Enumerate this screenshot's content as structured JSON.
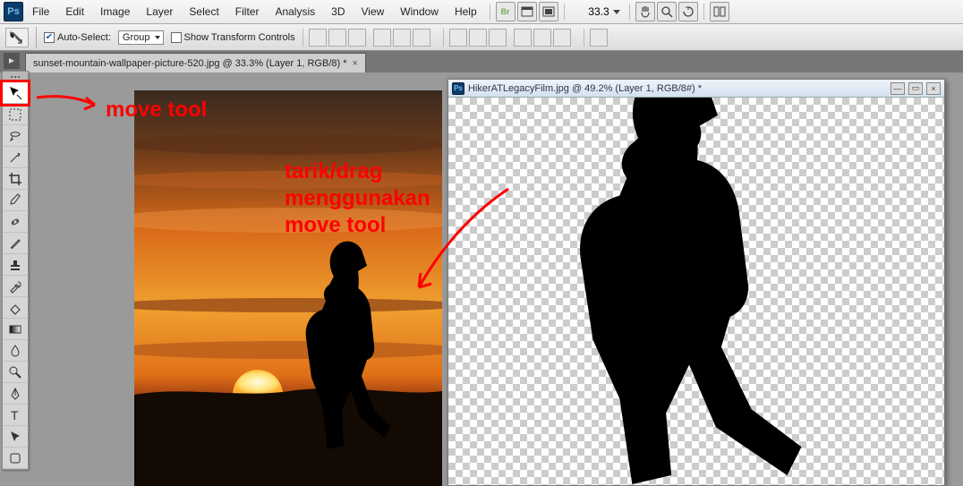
{
  "menubar": {
    "items": [
      "File",
      "Edit",
      "Image",
      "Layer",
      "Select",
      "Filter",
      "Analysis",
      "3D",
      "View",
      "Window",
      "Help"
    ],
    "zoom": "33.3"
  },
  "optionbar": {
    "auto_select_label": "Auto-Select:",
    "auto_select_value": "Group",
    "show_transform_label": "Show Transform Controls"
  },
  "document_tab": {
    "title": "sunset-mountain-wallpaper-picture-520.jpg @ 33.3% (Layer 1, RGB/8) *",
    "close": "×"
  },
  "float_window": {
    "title": "HikerATLegacyFilm.jpg @ 49.2% (Layer 1, RGB/8#) *"
  },
  "annotations": {
    "move_tool": "move tool",
    "drag_text": "tarik/drag\nmenggunakan\nmove tool"
  },
  "colors": {
    "red": "#ff0000",
    "sunset_top": "#3a2a20",
    "sunset_mid": "#d96a1a",
    "sunset_low": "#f0a030",
    "sunset_bottom": "#2a1408",
    "sun": "#fff0a0"
  }
}
